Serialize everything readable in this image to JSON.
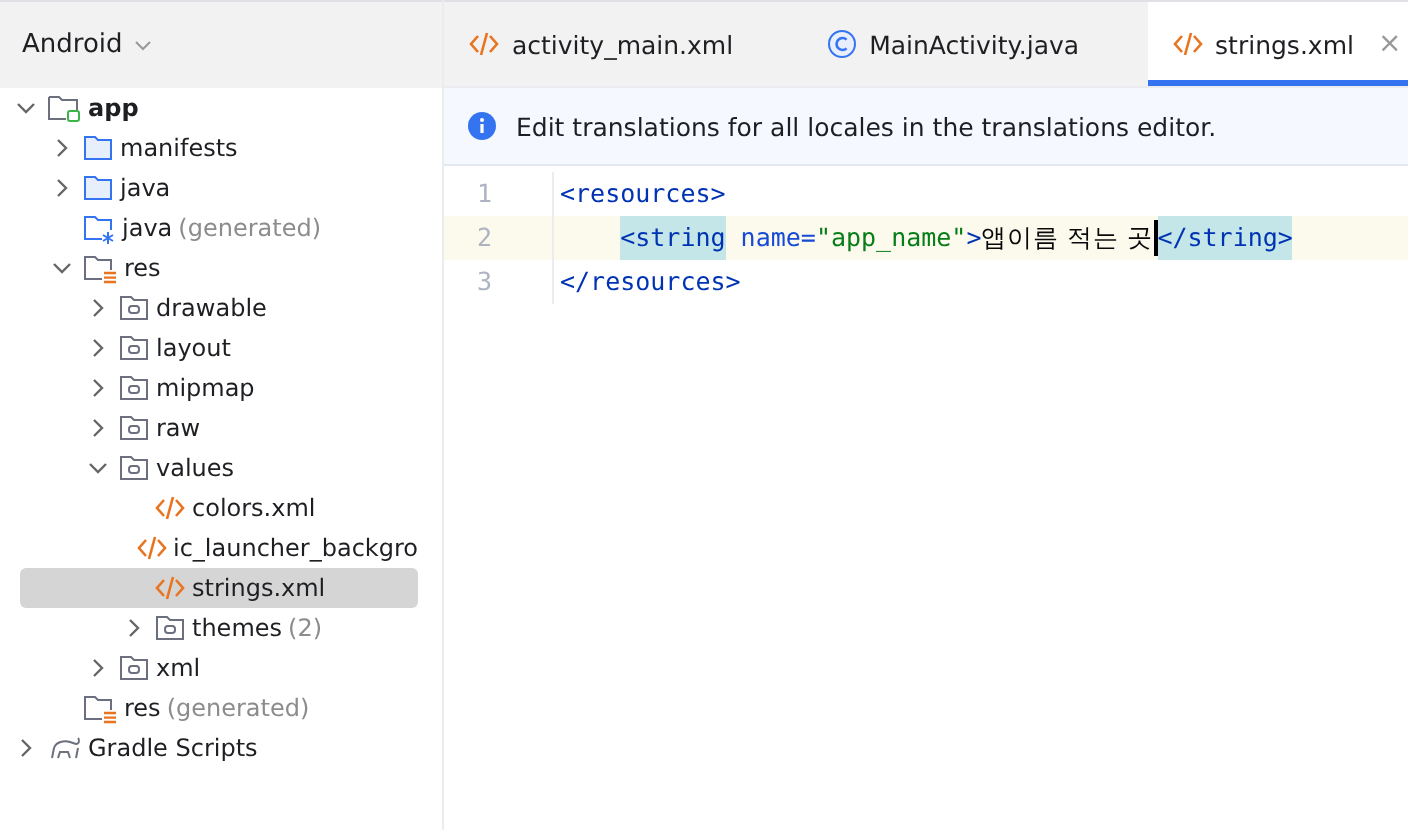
{
  "project_view": {
    "title": "Android"
  },
  "tree": [
    {
      "label": "app",
      "kind": "module",
      "expanded": true,
      "selected": false,
      "children": [
        {
          "label": "manifests",
          "kind": "folder",
          "expanded": false,
          "selected": false
        },
        {
          "label": "java",
          "kind": "folder",
          "expanded": false,
          "selected": false
        },
        {
          "label": "java",
          "suffix": "(generated)",
          "kind": "generated-folder",
          "selected": false
        },
        {
          "label": "res",
          "kind": "res-folder",
          "expanded": true,
          "selected": false,
          "children": [
            {
              "label": "drawable",
              "kind": "package",
              "expanded": false,
              "selected": false
            },
            {
              "label": "layout",
              "kind": "package",
              "expanded": false,
              "selected": false
            },
            {
              "label": "mipmap",
              "kind": "package",
              "expanded": false,
              "selected": false
            },
            {
              "label": "raw",
              "kind": "package",
              "expanded": false,
              "selected": false
            },
            {
              "label": "values",
              "kind": "package",
              "expanded": true,
              "selected": false,
              "children": [
                {
                  "label": "colors.xml",
                  "kind": "xml",
                  "selected": false
                },
                {
                  "label": "ic_launcher_backgro",
                  "kind": "xml",
                  "selected": false
                },
                {
                  "label": "strings.xml",
                  "kind": "xml",
                  "selected": true
                },
                {
                  "label": "themes",
                  "suffix": "(2)",
                  "kind": "package",
                  "expanded": false,
                  "selected": false
                }
              ]
            },
            {
              "label": "xml",
              "kind": "package",
              "expanded": false,
              "selected": false
            }
          ]
        },
        {
          "label": "res",
          "suffix": "(generated)",
          "kind": "res-folder",
          "selected": false
        }
      ]
    },
    {
      "label": "Gradle Scripts",
      "kind": "gradle",
      "expanded": false,
      "selected": false
    }
  ],
  "tabs": [
    {
      "label": "activity_main.xml",
      "kind": "xml",
      "selected": false
    },
    {
      "label": "MainActivity.java",
      "kind": "class",
      "selected": false
    },
    {
      "label": "strings.xml",
      "kind": "xml",
      "selected": true,
      "close": "×"
    }
  ],
  "banner": {
    "text": "Edit translations for all locales in the translations editor."
  },
  "editor": {
    "lines": [
      {
        "number": "1",
        "current": false,
        "segments": [
          {
            "kind": "tag",
            "text": "<resources>",
            "matched": false
          }
        ]
      },
      {
        "number": "2",
        "current": true,
        "segments": [
          {
            "kind": "indent"
          },
          {
            "kind": "tag",
            "text": "<string",
            "matched": true
          },
          {
            "kind": "attr",
            "text": " name="
          },
          {
            "kind": "value",
            "text": "\"app_name\""
          },
          {
            "kind": "tag",
            "text": ">",
            "matched": false
          },
          {
            "kind": "text",
            "text": "앱이름 적는 곳"
          },
          {
            "kind": "caret"
          },
          {
            "kind": "tag",
            "text": "</string>",
            "matched": true
          }
        ]
      },
      {
        "number": "3",
        "current": false,
        "segments": [
          {
            "kind": "tag",
            "text": "</resources>",
            "matched": false
          }
        ]
      }
    ]
  }
}
